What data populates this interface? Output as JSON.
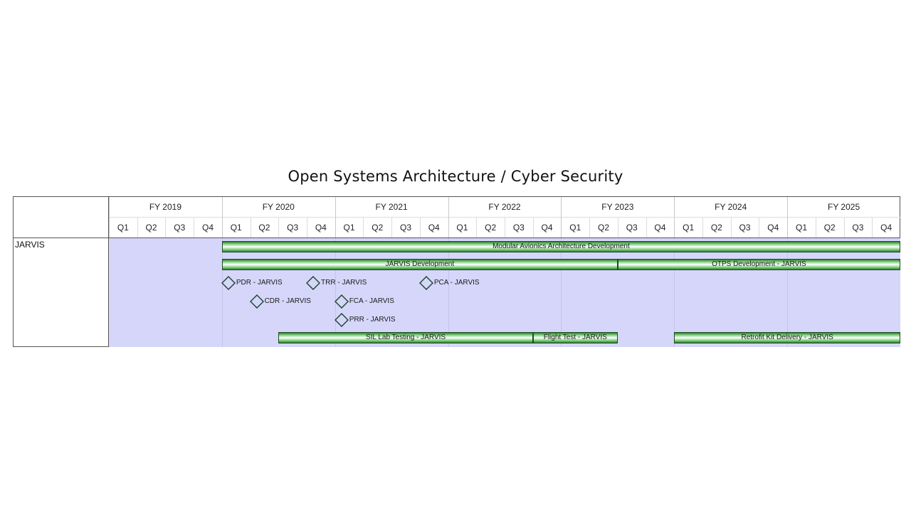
{
  "title": "Open Systems Architecture / Cyber Security",
  "row_label": "JARVIS",
  "years": [
    "FY 2019",
    "FY 2020",
    "FY 2021",
    "FY 2022",
    "FY 2023",
    "FY 2024",
    "FY 2025"
  ],
  "quarters": [
    "Q1",
    "Q2",
    "Q3",
    "Q4",
    "Q1",
    "Q2",
    "Q3",
    "Q4",
    "Q1",
    "Q2",
    "Q3",
    "Q4",
    "Q1",
    "Q2",
    "Q3",
    "Q4",
    "Q1",
    "Q2",
    "Q3",
    "Q4",
    "Q1",
    "Q2",
    "Q3",
    "Q4",
    "Q1",
    "Q2",
    "Q3",
    "Q4"
  ],
  "colors": {
    "plot_background": "#d6d6fb",
    "bar_green": "#2f7f2f",
    "milestone_outline": "#1e4a2e"
  },
  "tasks": [
    {
      "name": "Modular Avionics Architecture Development",
      "start": "FY 2020 Q1",
      "end": "FY 2025 Q4"
    },
    {
      "name": "JARVIS Development",
      "start": "FY 2020 Q1",
      "end": "FY 2023 Q2"
    },
    {
      "name": "OTPS Development - JARVIS",
      "start": "FY 2023 Q3",
      "end": "FY 2025 Q4"
    },
    {
      "name": "SIL Lab Testing - JARVIS",
      "start": "FY 2020 Q3",
      "end": "FY 2022 Q3"
    },
    {
      "name": "Flight Test - JARVIS",
      "start": "FY 2022 Q4",
      "end": "FY 2023 Q2"
    },
    {
      "name": "Retrofit Kit Delivery - JARVIS",
      "start": "FY 2024 Q1",
      "end": "FY 2025 Q4"
    }
  ],
  "milestones": [
    {
      "name": "PDR - JARVIS",
      "date": "FY 2020 Q1"
    },
    {
      "name": "TRR - JARVIS",
      "date": "FY 2020 Q4"
    },
    {
      "name": "PCA - JARVIS",
      "date": "FY 2021 Q4"
    },
    {
      "name": "CDR - JARVIS",
      "date": "FY 2020 Q2"
    },
    {
      "name": "FCA - JARVIS",
      "date": "FY 2021 Q1"
    },
    {
      "name": "PRR - JARVIS",
      "date": "FY 2021 Q1"
    }
  ]
}
